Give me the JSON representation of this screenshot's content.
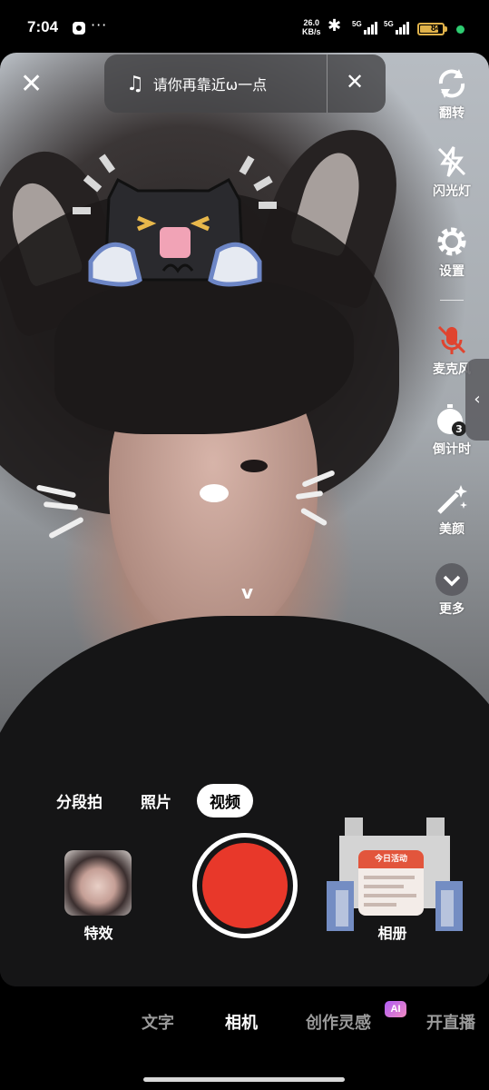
{
  "status_bar": {
    "time": "7:04",
    "more_indicator": "···",
    "net_speed_value": "26.0",
    "net_speed_unit": "KB/s",
    "sim1_label": "5G",
    "sim2_label": "5G",
    "battery_level": "84",
    "battery_color": "#e0b24a",
    "active_dot_color": "#2ecc71"
  },
  "top_bar": {
    "close_icon": "close-icon",
    "music_icon": "music-note-icon",
    "song_title": "请你再靠近ω一点",
    "remove_music_icon": "close-icon"
  },
  "toolbar": {
    "items": [
      {
        "icon": "flip-camera-icon",
        "label": "翻转"
      },
      {
        "icon": "flash-off-icon",
        "label": "闪光灯"
      },
      {
        "icon": "settings-gear-icon",
        "label": "设置"
      },
      {
        "icon": "mic-off-icon",
        "label": "麦克风"
      },
      {
        "icon": "countdown-timer-icon",
        "label": "倒计时"
      },
      {
        "icon": "beauty-wand-icon",
        "label": "美颜"
      },
      {
        "icon": "more-chevron-icon",
        "label": "更多"
      }
    ],
    "timer_value": "3",
    "mic_off_color": "#e0442f"
  },
  "viewfinder": {
    "face_mark": "v"
  },
  "capture_modes": {
    "tabs": [
      "分段拍",
      "照片",
      "视频"
    ],
    "active": "视频"
  },
  "capture_row": {
    "effects_label": "特效",
    "album_label": "相册",
    "album_thumb_banner": "今日活动",
    "shutter_color": "#e8382a"
  },
  "bottom_nav": {
    "items": [
      "文字",
      "相机",
      "创作灵感",
      "开直播"
    ],
    "active": "相机",
    "ai_badge": "AI"
  }
}
